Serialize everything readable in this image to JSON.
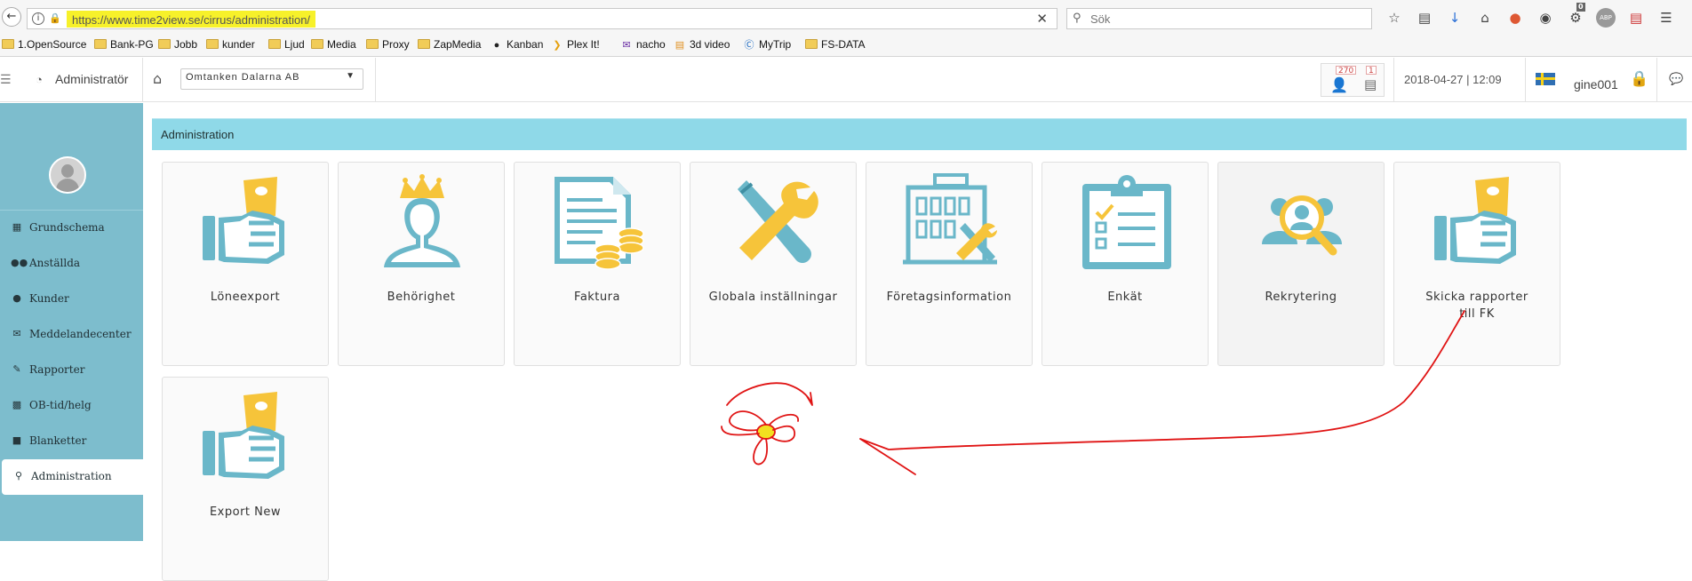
{
  "browser": {
    "url": "https://www.time2view.se/cirrus/administration/",
    "search_placeholder": "Sök",
    "bookmarks": [
      {
        "label": "1.OpenSource",
        "icon": "folder-icon"
      },
      {
        "label": "Bank-PG",
        "icon": "folder-icon"
      },
      {
        "label": "Jobb",
        "icon": "folder-icon"
      },
      {
        "label": "kunder",
        "icon": "folder-icon"
      },
      {
        "label": "Ljud",
        "icon": "folder-icon"
      },
      {
        "label": "Media",
        "icon": "folder-icon"
      },
      {
        "label": "Proxy",
        "icon": "folder-icon"
      },
      {
        "label": "ZapMedia",
        "icon": "folder-icon"
      },
      {
        "label": "Kanban",
        "icon": "kanban-icon"
      },
      {
        "label": "Plex It!",
        "icon": "plex-icon"
      },
      {
        "label": "nacho",
        "icon": "mail-icon"
      },
      {
        "label": "3d video",
        "icon": "rss-icon"
      },
      {
        "label": "MyTrip",
        "icon": "mytrip-icon"
      },
      {
        "label": "FS-DATA",
        "icon": "folder-icon"
      }
    ],
    "toolbar_badge": "0",
    "abp_label": "ABP"
  },
  "header": {
    "brand": "Administratör",
    "company": "Omtanken Dalarna AB",
    "badge_users": "270",
    "badge_docs": "1",
    "datetime": "2018-04-27 | 12:09",
    "username": "gine001"
  },
  "sidebar": {
    "items": [
      {
        "label": "Grundschema",
        "icon": "calendar-icon"
      },
      {
        "label": "Anställda",
        "icon": "users-icon"
      },
      {
        "label": "Kunder",
        "icon": "user-icon"
      },
      {
        "label": "Meddelandecenter",
        "icon": "envelope-icon"
      },
      {
        "label": "Rapporter",
        "icon": "pencil-icon"
      },
      {
        "label": "OB-tid/helg",
        "icon": "chart-icon"
      },
      {
        "label": "Blanketter",
        "icon": "file-icon"
      },
      {
        "label": "Administration",
        "icon": "key-icon"
      }
    ],
    "active": "Administration"
  },
  "main": {
    "panel_title": "Administration",
    "tiles": [
      {
        "label": "Löneexport",
        "icon": "hand-money-icon"
      },
      {
        "label": "Behörighet",
        "icon": "crowned-user-icon"
      },
      {
        "label": "Faktura",
        "icon": "invoice-coins-icon"
      },
      {
        "label": "Globala inställningar",
        "icon": "tools-icon"
      },
      {
        "label": "Företagsinformation",
        "icon": "building-tools-icon"
      },
      {
        "label": "Enkät",
        "icon": "clipboard-checklist-icon"
      },
      {
        "label": "Rekrytering",
        "icon": "people-search-icon"
      },
      {
        "label": "Skicka rapporter till FK",
        "icon": "hand-money-icon"
      },
      {
        "label": "Export New",
        "icon": "hand-money-icon"
      }
    ]
  },
  "colors": {
    "accent_teal": "#6ab7c9",
    "accent_yellow": "#f6c43a",
    "sidebar_bg": "#7dbdcd",
    "panel_header": "#8fd9e8",
    "url_highlight": "#f7f12a",
    "annotation_red": "#e01414"
  }
}
